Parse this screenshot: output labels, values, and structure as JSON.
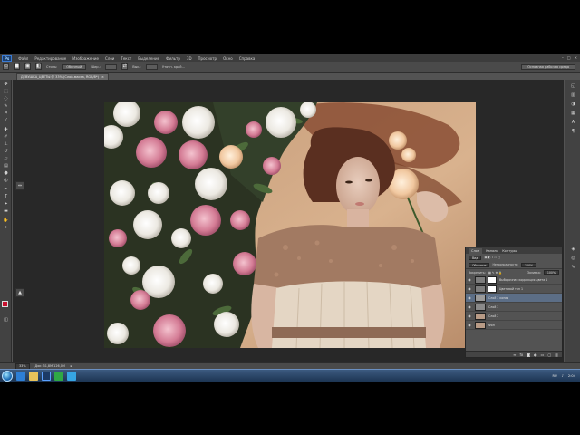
{
  "menu": {
    "logo": "Ps",
    "items": [
      "Файл",
      "Редактирование",
      "Изображение",
      "Слои",
      "Текст",
      "Выделение",
      "Фильтр",
      "3D",
      "Просмотр",
      "Окно",
      "Справка"
    ]
  },
  "options_bar": {
    "style_label": "Стиль:",
    "style_value": "Обычный",
    "width_label": "Шир.:",
    "height_label": "Выс.:",
    "refine_label": "Уточн. край...",
    "workspace": "Основная рабочая среда"
  },
  "document": {
    "tab_title": "ДЕВУШКА_ЦВЕТЫ @ 33% (Слой-маска, RGB/8*)",
    "close_glyph": "×"
  },
  "layers_panel": {
    "tabs": [
      "Слои",
      "Каналы",
      "Контуры"
    ],
    "kind_label": "Вид",
    "blend_mode": "Обычные",
    "opacity_label": "Непрозрачность:",
    "opacity_value": "100%",
    "lock_label": "Закрепить:",
    "fill_label": "Заливка:",
    "fill_value": "100%",
    "layers": [
      {
        "name": "Выборочная коррекция цвета 1",
        "selected": false
      },
      {
        "name": "Цветовой тон 1",
        "selected": false
      },
      {
        "name": "Слой 3 копия",
        "selected": true
      },
      {
        "name": "Слой 3",
        "selected": false
      },
      {
        "name": "Слой 2",
        "selected": false
      },
      {
        "name": "Фон",
        "selected": false
      }
    ]
  },
  "status_bar": {
    "zoom": "33%",
    "doc_info": "Док: 31,8M/126,0M"
  },
  "taskbar": {
    "lang": "RU",
    "time": "2:04"
  },
  "colors": {
    "foreground": "#c8102e",
    "background": "#ffffff",
    "accent": "#5c6e86"
  },
  "icons": {
    "tools": [
      "move-icon",
      "marquee-icon",
      "lasso-icon",
      "quick-select-icon",
      "crop-icon",
      "eyedropper-icon",
      "healing-icon",
      "brush-icon",
      "stamp-icon",
      "history-brush-icon",
      "eraser-icon",
      "gradient-icon",
      "blur-icon",
      "dodge-icon",
      "pen-icon",
      "type-icon",
      "path-select-icon",
      "shape-icon",
      "hand-icon",
      "zoom-icon"
    ]
  }
}
